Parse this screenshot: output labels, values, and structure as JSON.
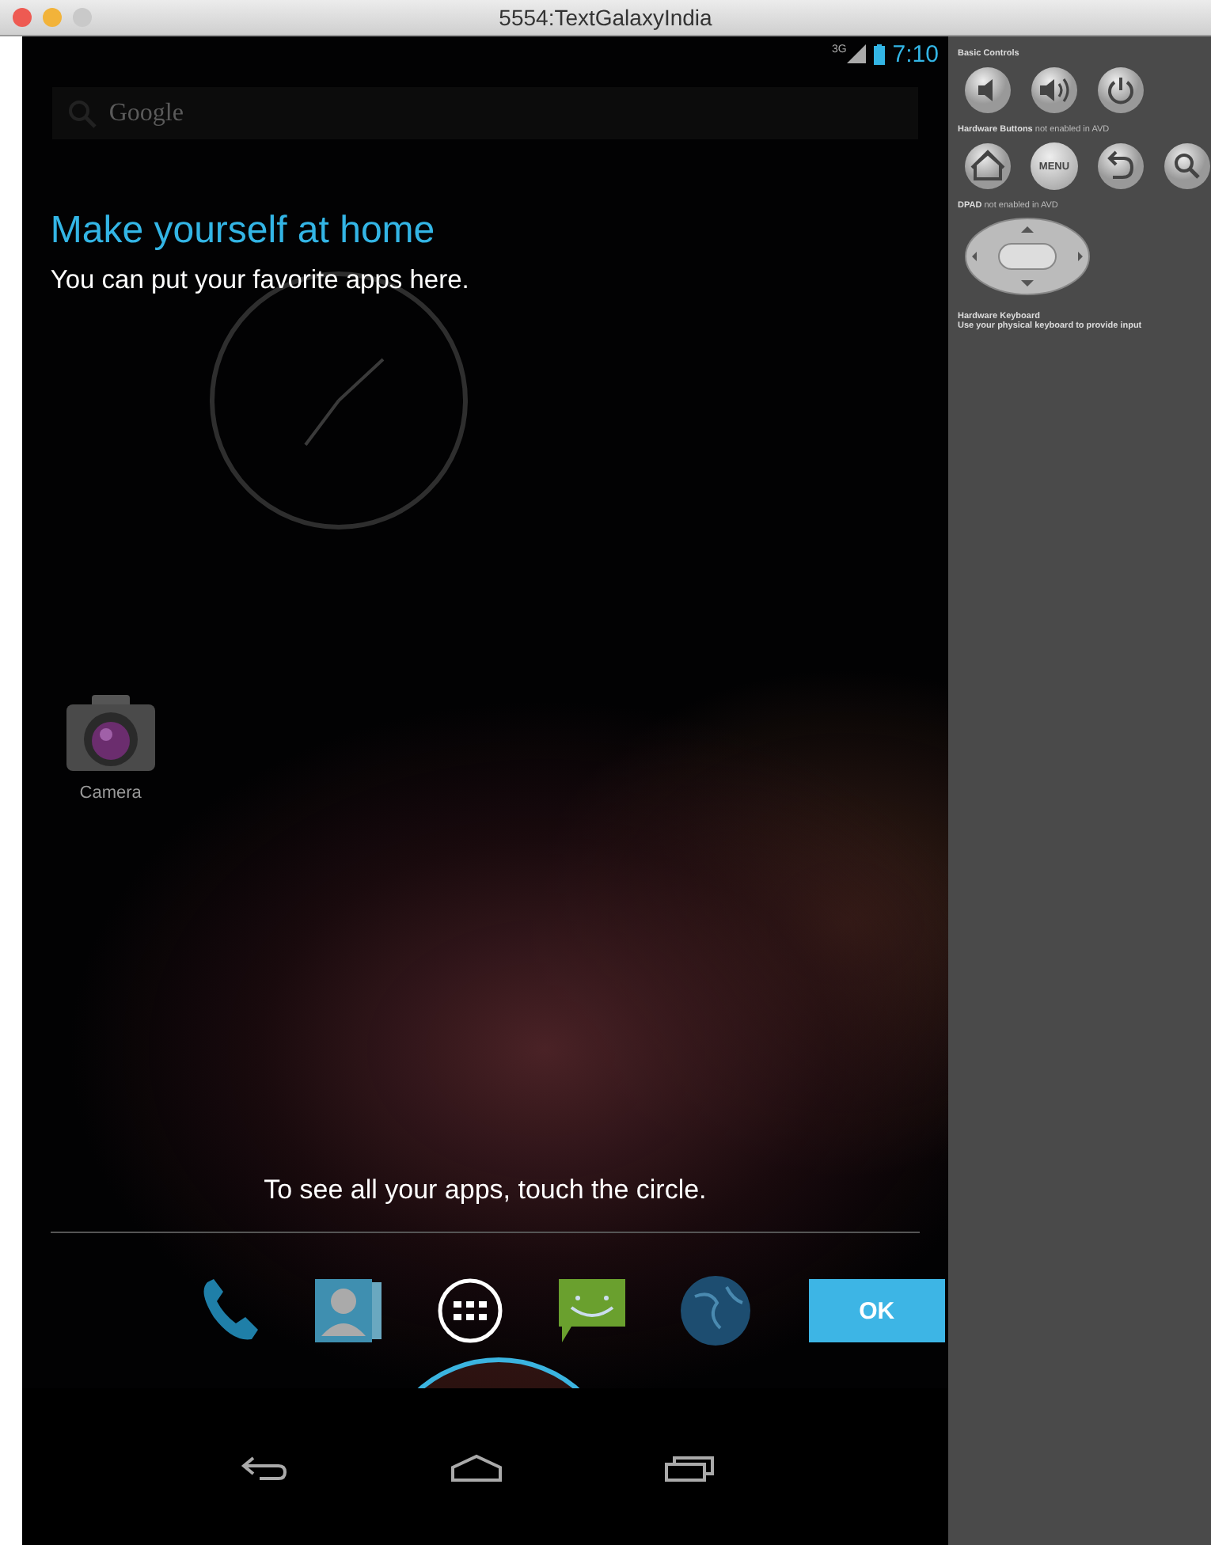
{
  "window": {
    "title": "5554:TextGalaxyIndia",
    "buttons": [
      {
        "color": "#ee5a52"
      },
      {
        "color": "#f2b33a"
      },
      {
        "color": "#c9c9c9"
      }
    ]
  },
  "status_bar": {
    "network": "3G",
    "time": "7:10"
  },
  "search": {
    "placeholder": "Google"
  },
  "cling": {
    "title": "Make yourself at home",
    "body": "You can put your favorite apps here."
  },
  "apps": [
    {
      "kind": "camera",
      "label": "Camera"
    }
  ],
  "hint": "To see all your apps, touch the circle.",
  "dock": [
    {
      "kind": "phone"
    },
    {
      "kind": "contacts"
    },
    {
      "kind": "all_apps"
    },
    {
      "kind": "messaging"
    },
    {
      "kind": "browser"
    }
  ],
  "ok_button": "OK",
  "nav_bar": [
    {
      "kind": "back"
    },
    {
      "kind": "home"
    },
    {
      "kind": "recent"
    }
  ],
  "panel": [
    {
      "kind": "buttons",
      "title": "Basic Controls",
      "buttons": [
        {
          "kind": "volume_down"
        },
        {
          "kind": "volume_up"
        },
        {
          "kind": "power"
        }
      ]
    },
    {
      "kind": "buttons",
      "title": "Hardware Buttons",
      "note": "not enabled in AVD",
      "buttons": [
        {
          "kind": "home"
        },
        {
          "kind": "menu",
          "label": "MENU"
        },
        {
          "kind": "back"
        },
        {
          "kind": "search"
        }
      ]
    },
    {
      "kind": "dpad",
      "title": "DPAD",
      "note": "not enabled in AVD"
    },
    {
      "kind": "text",
      "title": "Hardware Keyboard",
      "text": "Use your physical keyboard to provide input"
    }
  ]
}
